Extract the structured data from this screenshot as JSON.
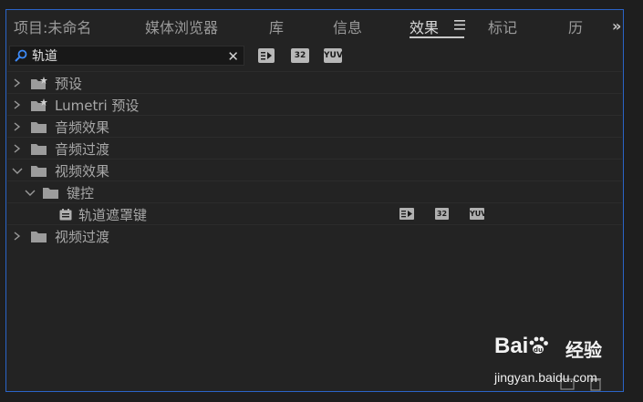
{
  "tabs": [
    {
      "label": "项目:未命名",
      "active": false
    },
    {
      "label": "媒体浏览器",
      "active": false
    },
    {
      "label": "库",
      "active": false
    },
    {
      "label": "信息",
      "active": false
    },
    {
      "label": "效果",
      "active": true
    },
    {
      "label": "标记",
      "active": false
    },
    {
      "label": "历",
      "active": false
    }
  ],
  "overflow_label": "»",
  "search": {
    "value": "轨道",
    "placeholder": ""
  },
  "filters": {
    "accelerated": "",
    "bit32": "32",
    "yuv": "YUV"
  },
  "tree": [
    {
      "label": "预设",
      "expanded": false
    },
    {
      "label": "Lumetri 预设",
      "expanded": false
    },
    {
      "label": "音频效果",
      "expanded": false
    },
    {
      "label": "音频过渡",
      "expanded": false
    },
    {
      "label": "视频效果",
      "expanded": true
    },
    {
      "label": "键控",
      "expanded": true
    },
    {
      "label": "轨道遮罩键",
      "badges": {
        "bit32": "32",
        "yuv": "YUV"
      }
    },
    {
      "label": "视频过渡",
      "expanded": false
    }
  ],
  "watermark": {
    "brand": "Bai",
    "brand_suffix": "du",
    "product": "经验",
    "site": "jingyan.baidu.com"
  },
  "colors": {
    "accent": "#2b64c7",
    "panel_bg": "#232323",
    "text": "#a8a8a8"
  }
}
